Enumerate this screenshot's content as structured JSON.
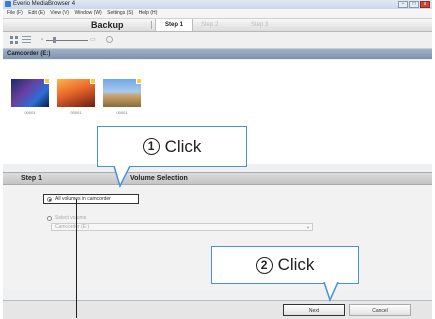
{
  "window": {
    "title": "Everio MediaBrowser 4",
    "menu": [
      "File (F)",
      "Edit (E)",
      "View (V)",
      "Window (W)",
      "Settings (S)",
      "Help (H)"
    ],
    "controls": {
      "minimize": "–",
      "maximize": "□",
      "close": "x"
    }
  },
  "header": {
    "title": "Backup",
    "steps": [
      "Step 1",
      "Step 2",
      "Step 3"
    ],
    "active_step": "Step 1"
  },
  "device": {
    "label": "Camcorder (E:)"
  },
  "thumbnails": [
    {
      "caption": "00001",
      "icon": "video-thumbnail-icon"
    },
    {
      "caption": "00001",
      "icon": "video-thumbnail-icon"
    },
    {
      "caption": "00001",
      "icon": "video-thumbnail-icon"
    }
  ],
  "step_bar": {
    "step_label": "Step 1",
    "section_title": "Volume Selection"
  },
  "options": {
    "all_volumes": "All volumes in camcorder",
    "select_volume": "Select volume",
    "dropdown_value": "Camcorder (E:)",
    "selected": "all_volumes"
  },
  "buttons": {
    "next": "Next",
    "cancel": "Cancel"
  },
  "callouts": [
    {
      "number": "1",
      "text": "Click"
    },
    {
      "number": "2",
      "text": "Click"
    }
  ],
  "colors": {
    "callout_border": "#4a8fe0",
    "camcorder_bar": "#8ea3bb"
  }
}
